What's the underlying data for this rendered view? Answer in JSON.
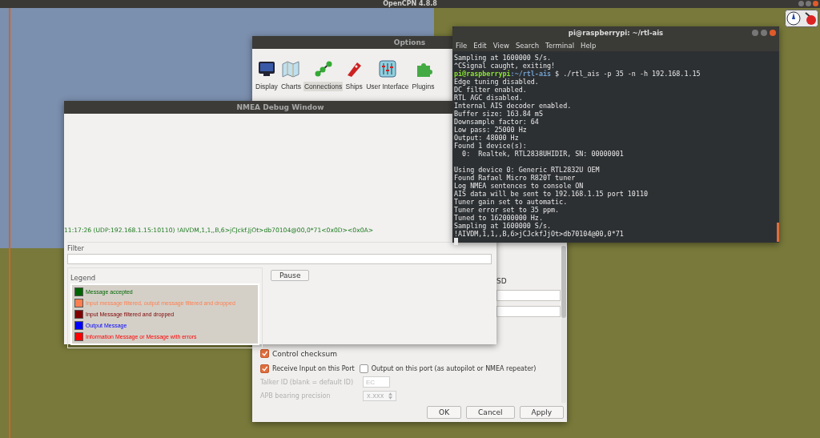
{
  "top_bar": {
    "title": "OpenCPN 4.8.8"
  },
  "options": {
    "title": "Options",
    "toolbar": [
      {
        "kind": "display",
        "label": "Display",
        "selected": false
      },
      {
        "kind": "charts",
        "label": "Charts",
        "selected": false
      },
      {
        "kind": "connections",
        "label": "Connections",
        "selected": true
      },
      {
        "kind": "ships",
        "label": "Ships",
        "selected": false
      },
      {
        "kind": "ui",
        "label": "User Interface",
        "selected": false
      },
      {
        "kind": "plugins",
        "label": "Plugins",
        "selected": false
      }
    ],
    "partial_label": "SD",
    "checkboxes": [
      {
        "label": "Control checksum",
        "checked": true
      }
    ],
    "port_options": [
      {
        "label": "Receive Input on this Port",
        "checked": true
      },
      {
        "label": "Output on this port (as autopilot or NMEA repeater)",
        "checked": false
      }
    ],
    "talker_id": {
      "label": "Talker ID (blank = default ID)",
      "placeholder": "EC",
      "disabled": true
    },
    "apb_precision": {
      "label": "APB bearing precision",
      "value": "x.xxx",
      "disabled": true
    },
    "buttons": [
      "OK",
      "Cancel",
      "Apply"
    ]
  },
  "nmea_debug": {
    "title": "NMEA Debug Window",
    "messages": [
      "11:17:26 (UDP:192.168.1.15:10110) !AIVDM,1,1,,B,6>jCJckf.JjOt>db70104@00,0*71<0x0D><0x0A>"
    ],
    "filter_label": "Filter",
    "legend_label": "Legend",
    "legend": [
      {
        "label": "Message accepted",
        "color": "#006400"
      },
      {
        "label": "Input message filtered, output message filtered and dropped",
        "color": "#ff7f50"
      },
      {
        "label": "Input Message filtered and dropped",
        "color": "#800000"
      },
      {
        "label": "Output Message",
        "color": "#0000ff"
      },
      {
        "label": "Information Message or Message with errors",
        "color": "#ff0000"
      }
    ],
    "pause_button": "Pause"
  },
  "terminal": {
    "title": "pi@raspberrypi: ~/rtl-ais",
    "menu": [
      "File",
      "Edit",
      "View",
      "Search",
      "Terminal",
      "Help"
    ],
    "lines": [
      {
        "kind": "output",
        "text": "Sampling at 1600000 S/s."
      },
      {
        "kind": "output",
        "text": "^CSignal caught, exiting!"
      },
      {
        "kind": "prompt",
        "user": "pi@raspberrypi",
        "path": ":~/rtl-ais",
        "command": " $ ./rtl_ais -p 35 -n -h 192.168.1.15"
      },
      {
        "kind": "output",
        "text": "Edge tuning disabled."
      },
      {
        "kind": "output",
        "text": "DC filter enabled."
      },
      {
        "kind": "output",
        "text": "RTL AGC disabled."
      },
      {
        "kind": "output",
        "text": "Internal AIS decoder enabled."
      },
      {
        "kind": "output",
        "text": "Buffer size: 163.84 mS"
      },
      {
        "kind": "output",
        "text": "Downsample factor: 64"
      },
      {
        "kind": "output",
        "text": "Low pass: 25000 Hz"
      },
      {
        "kind": "output",
        "text": "Output: 48000 Hz"
      },
      {
        "kind": "output",
        "text": "Found 1 device(s):"
      },
      {
        "kind": "output",
        "text": "  0:  Realtek, RTL2838UHIDIR, SN: 00000001"
      },
      {
        "kind": "blank"
      },
      {
        "kind": "output",
        "text": "Using device 0: Generic RTL2832U OEM"
      },
      {
        "kind": "output",
        "text": "Found Rafael Micro R820T tuner"
      },
      {
        "kind": "output",
        "text": "Log NMEA sentences to console ON"
      },
      {
        "kind": "output",
        "text": "AIS data will be sent to 192.168.1.15 port 10110"
      },
      {
        "kind": "output",
        "text": "Tuner gain set to automatic."
      },
      {
        "kind": "output",
        "text": "Tuner error set to 35 ppm."
      },
      {
        "kind": "output",
        "text": "Tuned to 162000000 Hz."
      },
      {
        "kind": "output",
        "text": "Sampling at 1600000 S/s."
      },
      {
        "kind": "output",
        "text": "!AIVDM,1,1,,B,6>jCJckfJjOt>db70104@00,0*71"
      }
    ]
  }
}
